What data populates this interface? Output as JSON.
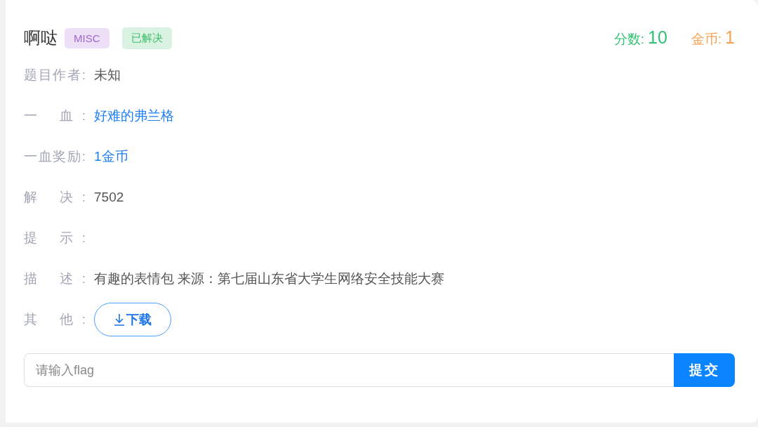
{
  "challenge": {
    "title": "啊哒",
    "tags": [
      {
        "label": "MISC",
        "color": "#a366d1"
      },
      {
        "label": "已解决",
        "color": "#3fbf6c"
      }
    ],
    "score": {
      "label": "分数:",
      "value": "10"
    },
    "coins": {
      "label": "金币:",
      "value": "1"
    }
  },
  "fields": [
    {
      "label": "题目作者:",
      "kind": "text",
      "value": "未知"
    },
    {
      "label": "一 血:",
      "kind": "link",
      "value": "好难的弗兰格"
    },
    {
      "label": "一血奖励:",
      "kind": "link",
      "value": "1金币"
    },
    {
      "label": "解 决:",
      "kind": "text",
      "value": "7502"
    },
    {
      "label": "提 示:",
      "kind": "text"
    },
    {
      "label": "描 述:",
      "kind": "text",
      "value": "有趣的表情包 来源：第七届山东省大学生网络安全技能大赛"
    },
    {
      "label": "其 他:",
      "kind": "download",
      "value": "下载"
    }
  ],
  "flag_input": {
    "placeholder": "请输入flag"
  },
  "submit_button": "提交"
}
